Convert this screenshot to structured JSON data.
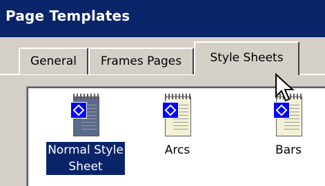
{
  "window": {
    "title": "Page Templates"
  },
  "tabs": [
    {
      "label": "General"
    },
    {
      "label": "Frames Pages"
    },
    {
      "label": "Style Sheets",
      "selected": true
    }
  ],
  "list": {
    "items": [
      {
        "label_line1": "Normal Style",
        "label_line2": "Sheet",
        "selected": true,
        "icon": "style-sheet-template-icon"
      },
      {
        "label": "Arcs",
        "selected": false,
        "icon": "style-sheet-template-icon"
      },
      {
        "label": "Bars",
        "selected": false,
        "icon": "style-sheet-template-icon"
      }
    ]
  },
  "colors": {
    "titlebar": "#0a246a",
    "selection": "#0a246a",
    "dialog_bg": "#d4d0c8",
    "badge": "#0000ff"
  }
}
